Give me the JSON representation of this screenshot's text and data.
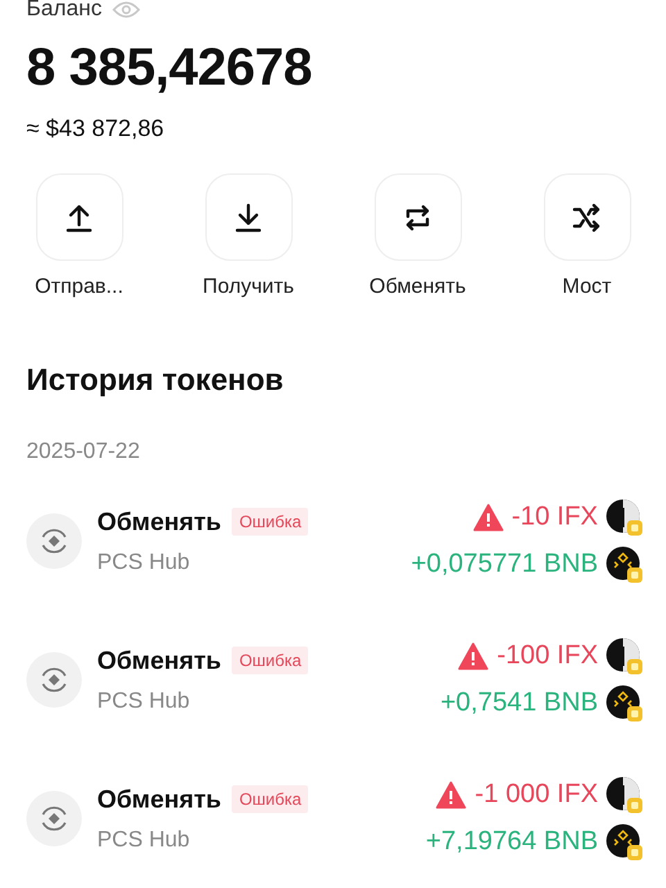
{
  "balance": {
    "label": "Баланс",
    "amount": "8 385,42678",
    "fiat": "≈ $43 872,86"
  },
  "actions": [
    {
      "kind": "send",
      "label": "Отправ..."
    },
    {
      "kind": "receive",
      "label": "Получить"
    },
    {
      "kind": "swap",
      "label": "Обменять"
    },
    {
      "kind": "bridge",
      "label": "Мост"
    }
  ],
  "history": {
    "title": "История токенов",
    "date": "2025-07-22",
    "rows": [
      {
        "title": "Обменять",
        "badge": "Ошибка",
        "subtitle": "PCS Hub",
        "amounts": [
          {
            "kind": "out",
            "warning": true,
            "text": "-10 IFX"
          },
          {
            "kind": "in",
            "warning": false,
            "text": "+0,075771 BNB"
          }
        ]
      },
      {
        "title": "Обменять",
        "badge": "Ошибка",
        "subtitle": "PCS Hub",
        "amounts": [
          {
            "kind": "out",
            "warning": true,
            "text": "-100 IFX"
          },
          {
            "kind": "in",
            "warning": false,
            "text": "+0,7541 BNB"
          }
        ]
      },
      {
        "title": "Обменять",
        "badge": "Ошибка",
        "subtitle": "PCS Hub",
        "amounts": [
          {
            "kind": "out",
            "warning": true,
            "text": "-1 000 IFX"
          },
          {
            "kind": "in",
            "warning": false,
            "text": "+7,19764 BNB"
          }
        ]
      }
    ]
  }
}
